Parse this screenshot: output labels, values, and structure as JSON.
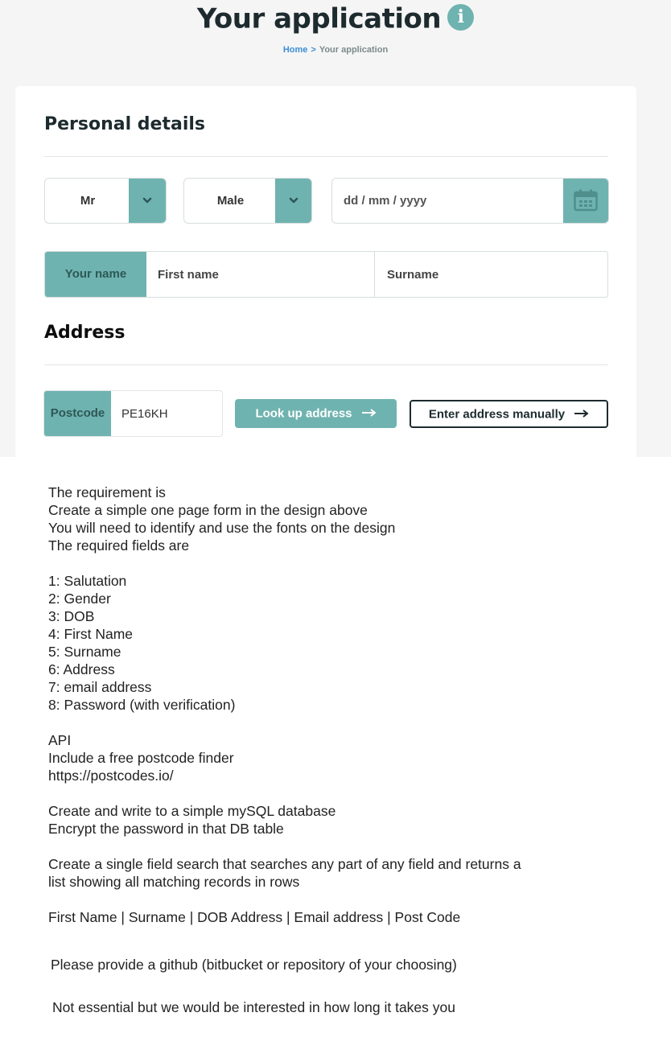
{
  "header": {
    "title": "Your application",
    "breadcrumb": {
      "home": "Home",
      "separator": ">",
      "current": "Your application"
    }
  },
  "personal": {
    "title": "Personal details",
    "salutation": "Mr",
    "gender": "Male",
    "dob_placeholder": "dd / mm / yyyy",
    "name_label": "Your name",
    "first_name_placeholder": "First name",
    "surname_placeholder": "Surname"
  },
  "address": {
    "title": "Address",
    "postcode_label": "Postcode",
    "postcode_value": "PE16KH",
    "lookup_button": "Look up address",
    "manual_button": "Enter address manually"
  },
  "icons": {
    "info": "info-icon",
    "chevron": "chevron-down-icon",
    "calendar": "calendar-icon",
    "arrow": "arrow-right-icon"
  },
  "colors": {
    "accent": "#6fb3b0",
    "link": "#3b8ed6",
    "heading": "#1d2b2f"
  },
  "requirements": [
    "The requirement is",
    "Create a simple one page form in the design above",
    "You will need to identify and use the fonts on the design",
    "The required fields are",
    "",
    "1: Salutation",
    "2: Gender",
    "3: DOB",
    "4: First Name",
    "5: Surname",
    "6: Address",
    "7: email address",
    "8: Password (with verification)",
    "",
    "API",
    "Include a free postcode finder",
    "https://postcodes.io/",
    "",
    "Create and write to a simple mySQL database",
    "Encrypt the password in that DB table",
    "",
    "Create a single field search that searches any part of any field and returns a",
    "list showing all matching records in rows",
    "",
    "First Name | Surname | DOB Address | Email address | Post Code"
  ],
  "footer_notes": [
    "Please provide a github (bitbucket or repository of your choosing)",
    "Not essential but we would be interested in how long it takes you"
  ]
}
